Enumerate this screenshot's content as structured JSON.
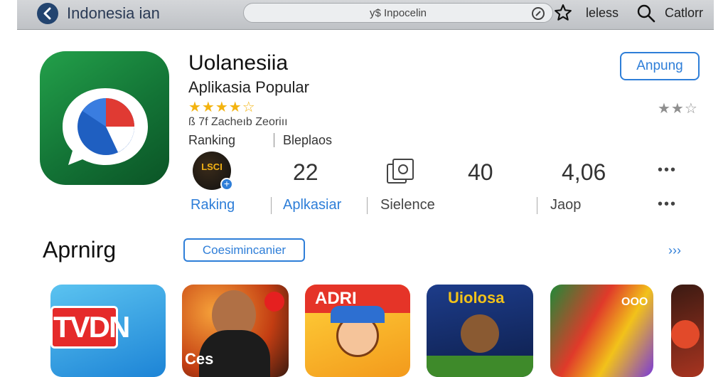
{
  "topbar": {
    "title": "Indonesia ian",
    "search_text": "y$ Inpocelin",
    "link1": "leless",
    "link2": "Catlorr"
  },
  "app": {
    "name": "Uolanesiia",
    "subtitle": "Aplikasia Popular",
    "stars": "★★★★☆",
    "meta": "ß 7f Zacheıb Zeoriıı",
    "ranking_label": "Ranking",
    "ranking_value": "Bleplaos",
    "install_label": "Anpung",
    "rating_stars": "★★☆"
  },
  "stats": {
    "badge_text": "LSCI",
    "count": "22",
    "number_right": "40",
    "score": "4,06",
    "more": "•••",
    "labels": {
      "raking": "Raking",
      "aplikasiar": "Aplkasiar",
      "sielence": "Sielence",
      "jaop": "Jaop"
    }
  },
  "section": {
    "title": "Aprnirg",
    "pill": "Coesimincanier",
    "see_all": "›››"
  },
  "tiles": [
    {
      "text": "TVDN"
    },
    {
      "text": "Ces"
    },
    {
      "text": "ADRI"
    },
    {
      "text": "Uiolosa"
    },
    {
      "text": "OOO"
    },
    {
      "text": ""
    }
  ],
  "colors": {
    "accent": "#2e7ed8",
    "icon_green": "#137436",
    "star_gold": "#f3b30f"
  }
}
